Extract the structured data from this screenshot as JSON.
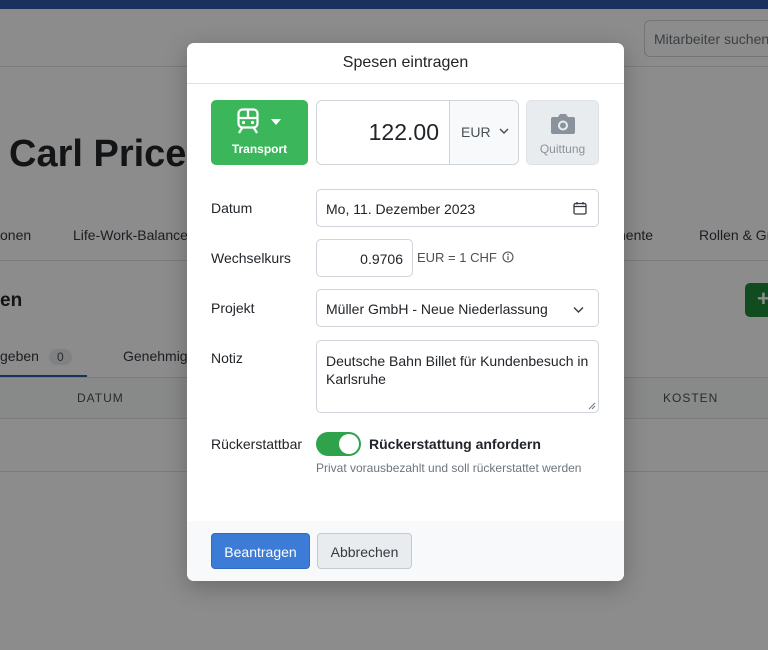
{
  "header": {
    "search_placeholder": "Mitarbeiter suchen"
  },
  "person": {
    "name": "Carl Price"
  },
  "subnav": {
    "items": [
      "onen",
      "Life-Work-Balance",
      "nente",
      "Rollen & Gr"
    ]
  },
  "expenses": {
    "title": "en",
    "add_label": "+",
    "tabs": [
      {
        "label": "geben",
        "count": "0"
      },
      {
        "label": "Genehmig"
      }
    ],
    "columns": {
      "datum": "DATUM",
      "kosten": "KOSTEN"
    }
  },
  "modal": {
    "title": "Spesen eintragen",
    "category": {
      "label": "Transport",
      "icon": "train-icon"
    },
    "amount": {
      "value": "122.00",
      "currency": "EUR"
    },
    "receipt": {
      "label": "Quittung",
      "icon": "camera-icon"
    },
    "date": {
      "label": "Datum",
      "value": "Mo, 11. Dezember 2023"
    },
    "exchange_rate": {
      "label": "Wechselkurs",
      "value": "0.9706",
      "hint": "EUR = 1 CHF"
    },
    "project": {
      "label": "Projekt",
      "value": "Müller GmbH - Neue Niederlassung"
    },
    "note": {
      "label": "Notiz",
      "value": "Deutsche Bahn Billet für Kundenbesuch in Karlsruhe"
    },
    "reimbursable": {
      "label": "Rückerstattbar",
      "toggle_label": "Rückerstattung anfordern",
      "toggle_on": true,
      "help": "Privat vorausbezahlt und soll rückerstattet werden"
    },
    "buttons": {
      "submit": "Beantragen",
      "cancel": "Abbrechen"
    }
  },
  "colors": {
    "brand": "#2f5aa8",
    "category_button": "#3cb65b",
    "toggle_on": "#2fa24c",
    "primary_button": "#3c7bd6"
  }
}
